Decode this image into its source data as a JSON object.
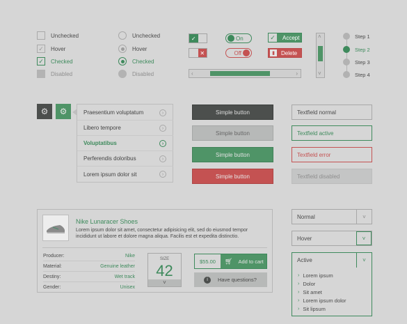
{
  "checkboxes": [
    {
      "label": "Unchecked",
      "state": "unchecked"
    },
    {
      "label": "Hover",
      "state": "hover"
    },
    {
      "label": "Checked",
      "state": "checked"
    },
    {
      "label": "Disabled",
      "state": "disabled"
    }
  ],
  "radios": [
    {
      "label": "Unchecked",
      "state": "unchecked"
    },
    {
      "label": "Hover",
      "state": "hover"
    },
    {
      "label": "Checked",
      "state": "checked"
    },
    {
      "label": "Disabled",
      "state": "disabled"
    }
  ],
  "toggles": {
    "on_label": "On",
    "off_label": "Off"
  },
  "actions": {
    "accept": "Accept",
    "delete": "Delete"
  },
  "slider": {
    "value_fraction": 0.5
  },
  "steps": [
    {
      "label": "Step 1",
      "active": false
    },
    {
      "label": "Step 2",
      "active": true
    },
    {
      "label": "Step 3",
      "active": false
    },
    {
      "label": "Step 4",
      "active": false
    }
  ],
  "menu": {
    "items": [
      {
        "label": "Praesentium voluptatum",
        "active": false
      },
      {
        "label": "Libero tempore",
        "active": false
      },
      {
        "label": "Voluptatibus",
        "active": true
      },
      {
        "label": "Perferendis doloribus",
        "active": false
      },
      {
        "label": "Lorem ipsum dolor sit",
        "active": false
      }
    ]
  },
  "buttons": [
    {
      "label": "Simple button",
      "variant": "dark",
      "color": "#4c4f4d"
    },
    {
      "label": "Simple button",
      "variant": "light",
      "color": "#b7b9b8"
    },
    {
      "label": "Simple button",
      "variant": "green",
      "color": "#4f9467"
    },
    {
      "label": "Simple button",
      "variant": "red",
      "color": "#c45252"
    }
  ],
  "textfields": [
    {
      "label": "Textfield normal",
      "state": "normal"
    },
    {
      "label": "Textfield active",
      "state": "active"
    },
    {
      "label": "Textfield error",
      "state": "error"
    },
    {
      "label": "Textfield disabled",
      "state": "disabled"
    }
  ],
  "product": {
    "title": "Nike Lunaracer Shoes",
    "description": "Lorem ipsum dolor sit amet, consectetur adipisicing elit, sed do eiusmod tempor incididunt ut labore et dolore magna aliqua. Facilis est et expedita distinctio.",
    "specs": [
      {
        "key": "Producer:",
        "value": "Nike"
      },
      {
        "key": "Material:",
        "value": "Genuine leather"
      },
      {
        "key": "Destiny:",
        "value": "Wet track"
      },
      {
        "key": "Gender:",
        "value": "Unisex"
      }
    ],
    "size_label": "SIZE",
    "size_value": "42",
    "price": "$55.00",
    "add_to_cart": "Add to cart",
    "questions": "Have questions?"
  },
  "dropdowns": {
    "normal": "Normal",
    "hover": "Hover",
    "active": "Active",
    "options": [
      "Lorem ipsum",
      "Dolor",
      "Sit amet",
      "Lorem ipsum dolor",
      "Sit lipsum"
    ]
  },
  "colors": {
    "green": "#3e8a5c",
    "red": "#c45252",
    "background": "#d6d6d6"
  }
}
